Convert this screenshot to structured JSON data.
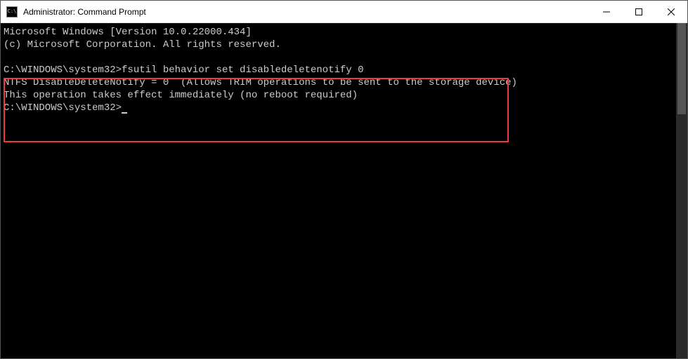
{
  "window": {
    "title": "Administrator: Command Prompt",
    "icon_text": "C:\\"
  },
  "terminal": {
    "line1": "Microsoft Windows [Version 10.0.22000.434]",
    "line2": "(c) Microsoft Corporation. All rights reserved.",
    "blank1": "",
    "prompt1_path": "C:\\WINDOWS\\system32>",
    "prompt1_cmd": "fsutil behavior set disabledeletenotify 0",
    "output1": "NTFS DisableDeleteNotify = 0  (Allows TRIM operations to be sent to the storage device)",
    "blank2": "",
    "output2": "This operation takes effect immediately (no reboot required)",
    "blank3": "",
    "prompt2_path": "C:\\WINDOWS\\system32>"
  },
  "colors": {
    "highlight_border": "#ed3b3b",
    "terminal_bg": "#000000",
    "terminal_fg": "#cccccc"
  }
}
